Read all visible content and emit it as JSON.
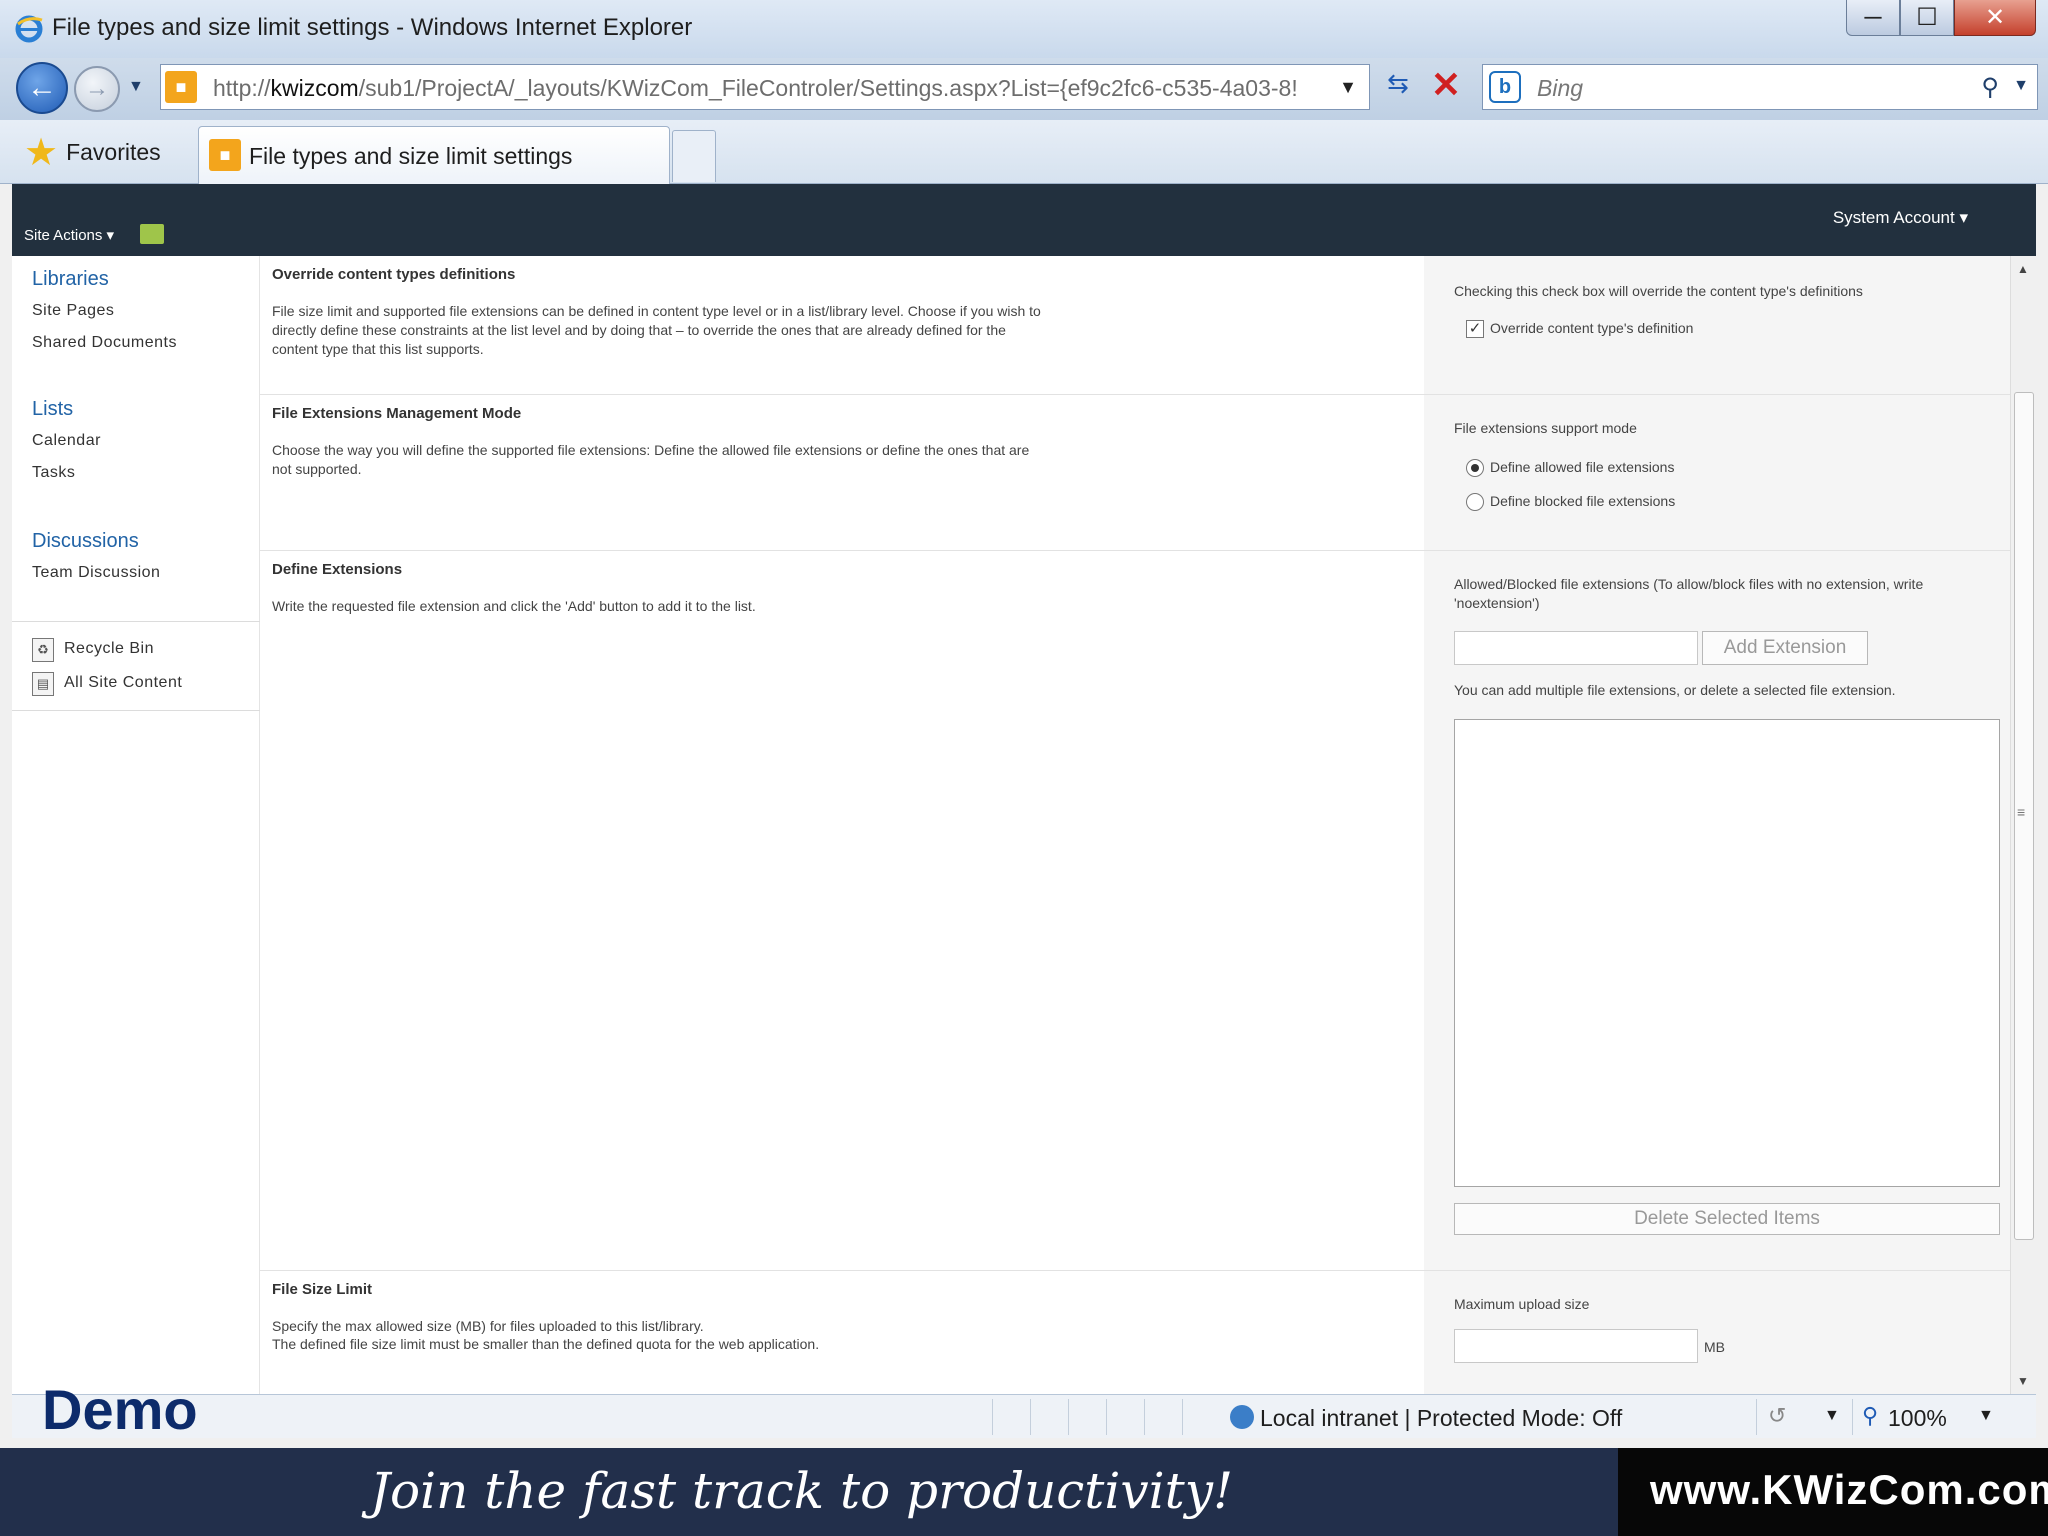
{
  "window": {
    "title": "File types and size limit settings - Windows Internet Explorer",
    "min": "─",
    "max": "☐",
    "close": "✕"
  },
  "address": {
    "url_prefix": "http://",
    "url_host": "kwizcom",
    "url_rest": "/sub1/ProjectA/_layouts/KWizCom_FileControler/Settings.aspx?List={ef9c2fc6-c535-4a03-8!",
    "search_placeholder": "Bing"
  },
  "favorites": {
    "label": "Favorites",
    "tab_label": "File types and size limit settings"
  },
  "ribbon": {
    "site_actions": "Site Actions ▾",
    "account": "System Account ▾"
  },
  "left_nav": {
    "libraries": "Libraries",
    "site_pages": "Site Pages",
    "shared_documents": "Shared Documents",
    "lists": "Lists",
    "calendar": "Calendar",
    "tasks": "Tasks",
    "discussions": "Discussions",
    "team_discussion": "Team Discussion",
    "recycle_bin": "Recycle Bin",
    "all_site_content": "All Site Content"
  },
  "sections": {
    "override": {
      "title": "Override content types definitions",
      "desc": "File size limit and supported file extensions can be defined in content type level or in a list/library level. Choose if you wish to directly define these constraints at the list level and by doing that – to override the ones that are already defined for the content type that this list supports.",
      "right_label": "Checking this check box will override the content type's definitions",
      "checkbox_label": "Override content type's definition",
      "checked": true
    },
    "mode": {
      "title": "File Extensions Management Mode",
      "desc": "Choose the way you will define the supported file extensions: Define the allowed file extensions or define the ones that are not supported.",
      "right_label": "File extensions support mode",
      "option_allowed": "Define allowed file extensions",
      "option_blocked": "Define blocked file extensions",
      "selected": "allowed"
    },
    "define": {
      "title": "Define Extensions",
      "desc": "Write the requested file extension and click the 'Add' button to add it to the list.",
      "right_label": "Allowed/Blocked file extensions (To allow/block files with no extension, write 'noextension')",
      "input_value": "",
      "add_button": "Add Extension",
      "hint": "You can add multiple file extensions, or delete a selected file extension.",
      "items": [],
      "delete_button": "Delete Selected Items"
    },
    "size": {
      "title": "File Size Limit",
      "desc_1": "Specify the max allowed size (MB) for files uploaded to this list/library.",
      "desc_2": "The defined file size limit must be smaller than the defined quota for the web application.",
      "right_label": "Maximum upload size",
      "input_value": "",
      "unit": "MB"
    }
  },
  "status": {
    "demo": "Demo",
    "zone": "Local intranet | Protected Mode: Off",
    "zoom": "100%"
  },
  "banner": {
    "slogan": "Join the fast track to productivity!",
    "site": "www.KWizCom.com"
  },
  "colors": {
    "ribbon": "#22303e",
    "nav_link": "#2163a6",
    "banner": "#222f4b"
  }
}
